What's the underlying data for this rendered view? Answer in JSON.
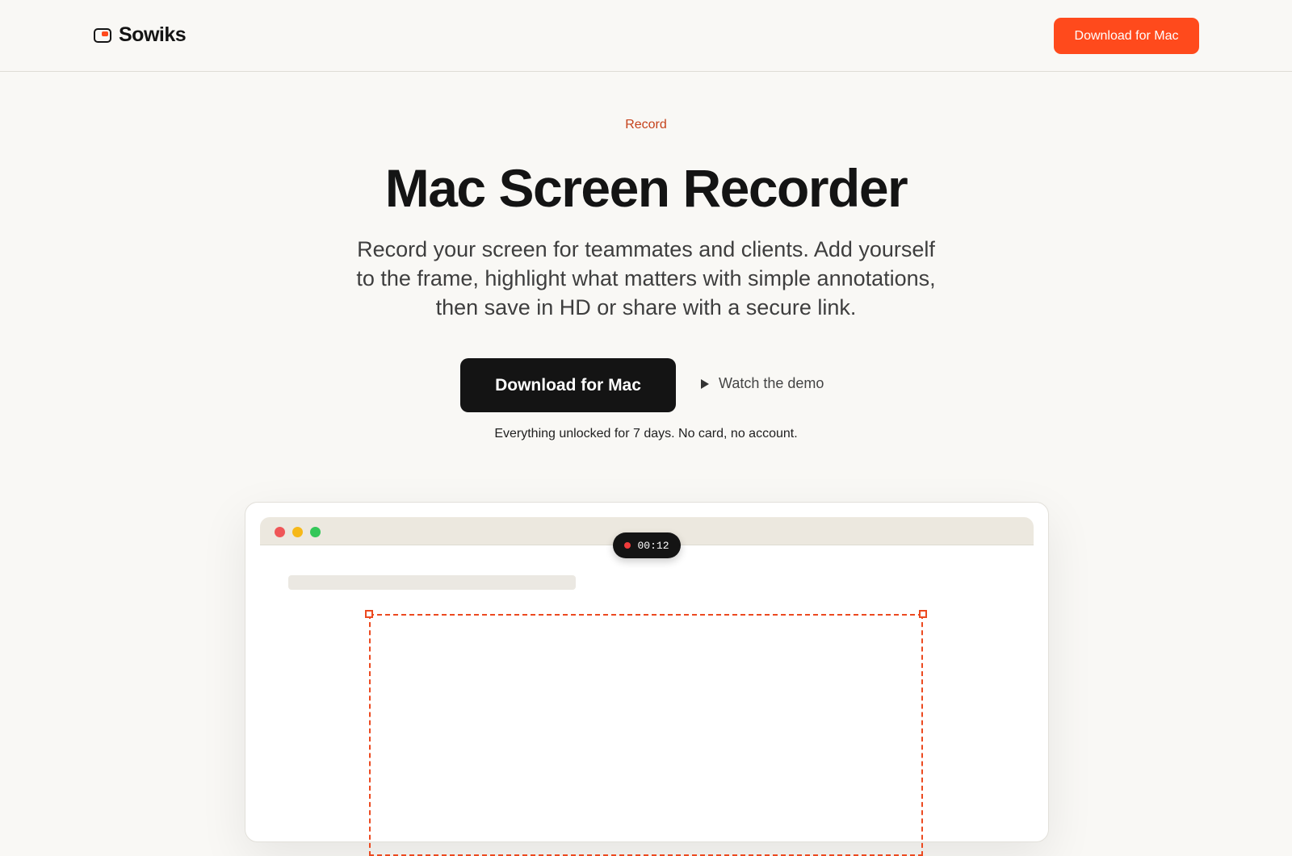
{
  "header": {
    "brand_name": "Sowiks",
    "cta_label": "Download for Mac"
  },
  "hero": {
    "eyebrow": "Record",
    "title": "Mac Screen Recorder",
    "subtitle": "Record your screen for teammates and clients. Add yourself to the frame, highlight what matters with simple annotations, then save in HD or share with a secure link.",
    "primary_cta": "Download for Mac",
    "secondary_cta": "Watch the demo",
    "note": "Everything unlocked for 7 days. No card, no account."
  },
  "mock": {
    "recording_time": "00:12"
  },
  "colors": {
    "accent": "#ff4a1c",
    "background": "#f9f8f5",
    "dark": "#141414"
  }
}
